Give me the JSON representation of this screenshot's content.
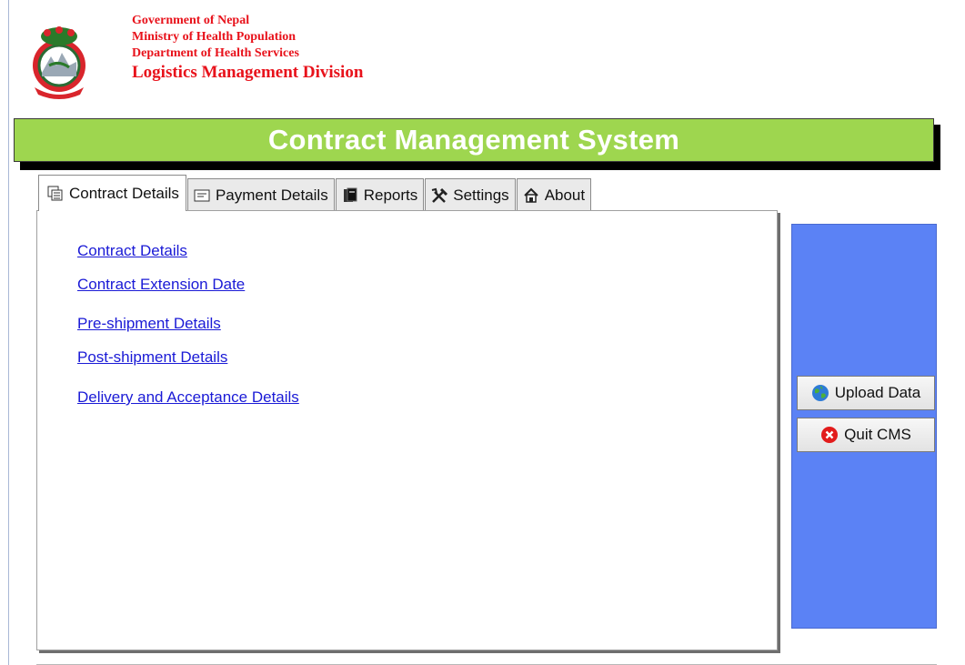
{
  "org": {
    "line1": "Government of Nepal",
    "line2": "Ministry of Health  Population",
    "line3": "Department of Health Services",
    "line4": "Logistics Management Division"
  },
  "banner": {
    "title": "Contract Management System"
  },
  "tabs": [
    {
      "label": "Contract Details",
      "icon": "contract-details-icon"
    },
    {
      "label": "Payment Details",
      "icon": "payment-details-icon"
    },
    {
      "label": "Reports",
      "icon": "reports-icon"
    },
    {
      "label": "Settings",
      "icon": "settings-tools-icon"
    },
    {
      "label": "About",
      "icon": "house-icon"
    }
  ],
  "links": [
    "Contract Details",
    "Contract Extension Date",
    "Pre-shipment Details",
    "Post-shipment Details",
    "Delivery and Acceptance Details"
  ],
  "buttons": {
    "upload": "Upload Data",
    "quit": "Quit CMS"
  },
  "colors": {
    "banner": "#9ed64f",
    "side_panel": "#5b82f5",
    "org_text": "#e8121b",
    "link": "#1a1ad6"
  }
}
